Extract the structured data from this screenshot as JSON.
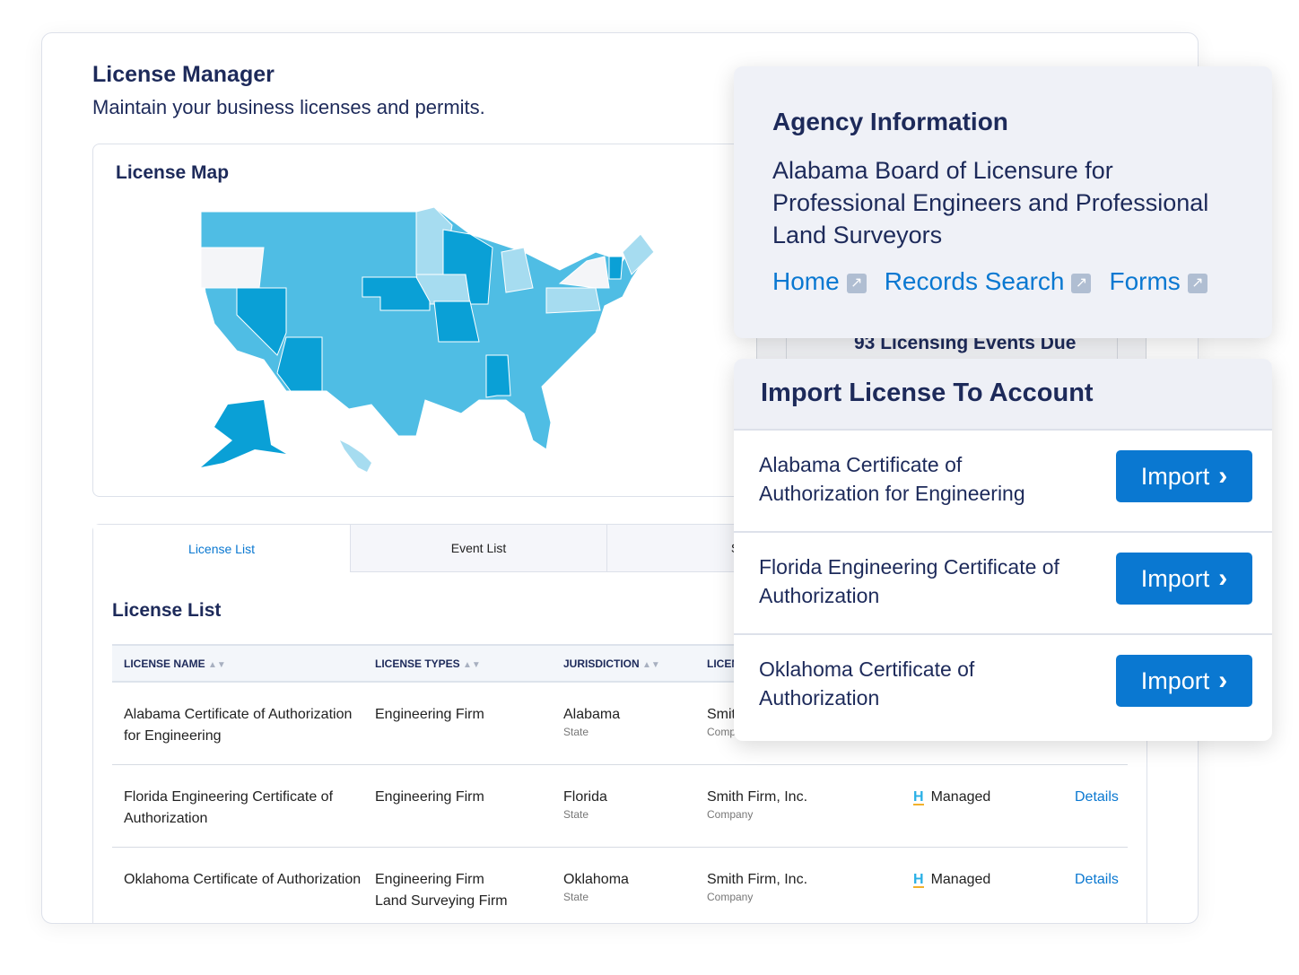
{
  "header": {
    "title": "License Manager",
    "subtitle": "Maintain your business licenses and permits."
  },
  "map": {
    "title": "License Map",
    "colors": {
      "base": "#4fbde4",
      "dark": "#0aa0d6",
      "light": "#a6dcf0",
      "none": "#f4f5f8"
    }
  },
  "tabs": [
    {
      "label": "License List"
    },
    {
      "label": "Event List"
    },
    {
      "label": "S"
    }
  ],
  "list": {
    "title": "License List",
    "columns": [
      "LICENSE NAME",
      "LICENSE TYPES",
      "JURISDICTION",
      "LICEN"
    ],
    "rows": [
      {
        "name": "Alabama Certificate of Authorization for Engineering",
        "types": [
          "Engineering Firm"
        ],
        "jurisdiction": "Alabama",
        "jur_type": "State",
        "licensee": "Smit",
        "licensee_type": "Comp",
        "status": "",
        "action": ""
      },
      {
        "name": "Florida Engineering Certificate of Authorization",
        "types": [
          "Engineering Firm"
        ],
        "jurisdiction": "Florida",
        "jur_type": "State",
        "licensee": "Smith Firm, Inc.",
        "licensee_type": "Company",
        "status": "Managed",
        "action": "Details"
      },
      {
        "name": "Oklahoma Certificate of Authorization",
        "types": [
          "Engineering Firm",
          "Land Surveying Firm"
        ],
        "jurisdiction": "Oklahoma",
        "jur_type": "State",
        "licensee": "Smith Firm, Inc.",
        "licensee_type": "Company",
        "status": "Managed",
        "action": "Details"
      }
    ]
  },
  "events": {
    "label": "93 Licensing Events Due"
  },
  "agency": {
    "title": "Agency Information",
    "name": "Alabama Board of Licensure for Professional Engineers and Professional Land Surveyors",
    "links": [
      "Home",
      "Records Search",
      "Forms"
    ]
  },
  "import": {
    "title": "Import License To Account",
    "items": [
      {
        "name": "Alabama Certificate of Authorization for Engineering",
        "button": "Import"
      },
      {
        "name": "Florida Engineering Certificate of Authorization",
        "button": "Import"
      },
      {
        "name": "Oklahoma Certificate of Authorization",
        "button": "Import"
      }
    ]
  }
}
